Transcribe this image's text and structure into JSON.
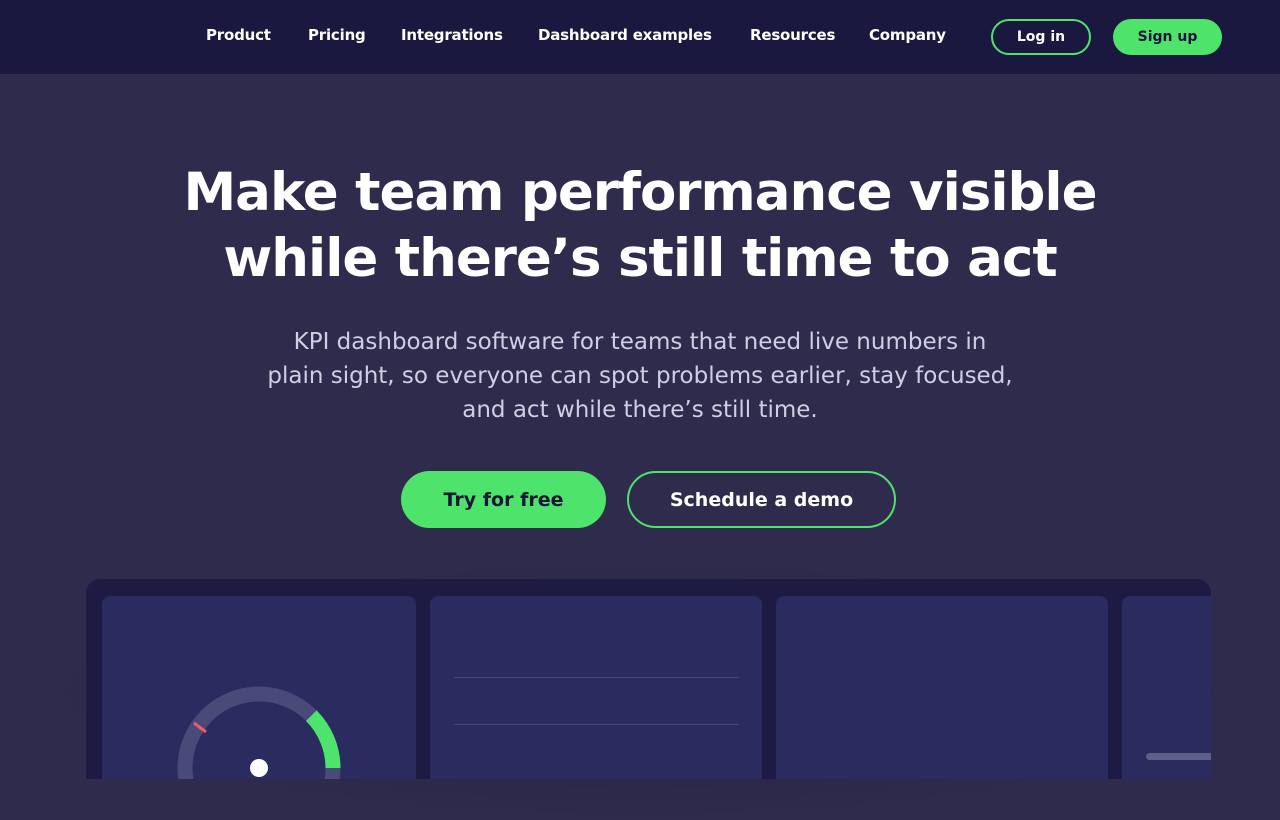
{
  "nav": {
    "links": [
      "Product",
      "Pricing",
      "Integrations",
      "Dashboard examples",
      "Resources",
      "Company"
    ],
    "login_label": "Log in",
    "signup_label": "Sign up"
  },
  "hero": {
    "title_lines": [
      "Make team performance visible",
      "while there’s still time to act"
    ],
    "subtitle_lines": [
      "KPI dashboard software for teams that need live numbers in",
      "plain sight, so everyone can spot problems earlier, stay focused,",
      "and act while there’s still time."
    ],
    "primary_cta": "Try for free",
    "secondary_cta": "Schedule a demo"
  },
  "colors": {
    "nav_bg": "#1b1840",
    "page_bg": "#2e2b4c",
    "accent": "#4ee46c",
    "panel_bg": "#2a2b5e",
    "dashboard_bg": "#1d1a44"
  },
  "dashboard_preview": {
    "gauge_icon": "gauge-icon"
  }
}
